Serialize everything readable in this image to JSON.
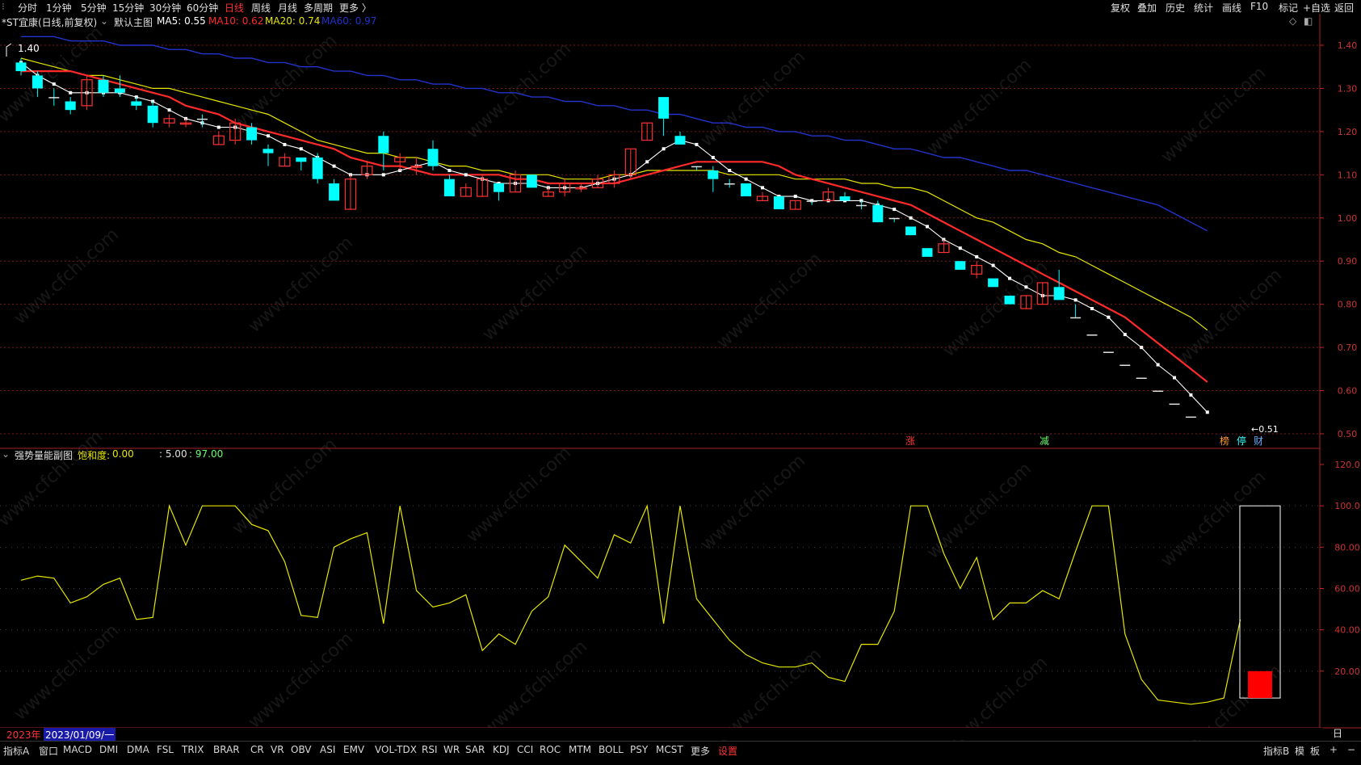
{
  "topbar": {
    "left_items": [
      "分时",
      "1分钟",
      "5分钟",
      "15分钟",
      "30分钟",
      "60分钟",
      "日线",
      "周线",
      "月线",
      "多周期",
      "更多 〉"
    ],
    "active_item": "日线",
    "right_items": [
      "复权",
      "叠加",
      "历史",
      "统计",
      "画线",
      "F10",
      "标记",
      "+自选",
      "返回"
    ]
  },
  "main_chart": {
    "title": "*ST宜康(日线,前复权)",
    "template": "默认主图",
    "ma5": {
      "label": "MA5:",
      "value": "0.55",
      "color": "#ffffff"
    },
    "ma10": {
      "label": "MA10:",
      "value": "0.62",
      "color": "#ff2a2a"
    },
    "ma20": {
      "label": "MA20:",
      "value": "0.74",
      "color": "#e6e600"
    },
    "ma60": {
      "label": "MA60:",
      "value": "0.97",
      "color": "#2233cc"
    },
    "high_marker": "1.40",
    "low_marker": "0.51",
    "y_ticks": [
      "1.40",
      "1.30",
      "1.20",
      "1.10",
      "1.00",
      "0.90",
      "0.80",
      "0.70",
      "0.60",
      "0.50"
    ],
    "event_tags": [
      {
        "text": "涨",
        "color": "#ff3333"
      },
      {
        "text": "减",
        "color": "#66ff66"
      },
      {
        "text": "榜",
        "color": "#ff9933"
      },
      {
        "text": "停",
        "color": "#33ffff"
      },
      {
        "text": "财",
        "color": "#66aaff"
      }
    ]
  },
  "sub_chart": {
    "title": "强势量能副图",
    "saturation_label": "饱和度:",
    "saturation_value": "0.00",
    "param1": ": 5.00",
    "param2": ": 97.00",
    "y_ticks": [
      "120.0",
      "100.0",
      "80.00",
      "60.00",
      "40.00",
      "20.00"
    ]
  },
  "chart_data": {
    "type": "candlestick",
    "price_range": [
      0.5,
      1.4
    ],
    "candles": [
      {
        "o": 1.36,
        "c": 1.34,
        "h": 1.37,
        "l": 1.33,
        "up": false
      },
      {
        "o": 1.33,
        "c": 1.3,
        "h": 1.34,
        "l": 1.28,
        "up": false
      },
      {
        "o": 1.28,
        "c": 1.28,
        "h": 1.3,
        "l": 1.26,
        "up": false
      },
      {
        "o": 1.27,
        "c": 1.25,
        "h": 1.28,
        "l": 1.24,
        "up": false
      },
      {
        "o": 1.26,
        "c": 1.32,
        "h": 1.33,
        "l": 1.25,
        "up": true
      },
      {
        "o": 1.32,
        "c": 1.29,
        "h": 1.33,
        "l": 1.28,
        "up": false
      },
      {
        "o": 1.3,
        "c": 1.29,
        "h": 1.33,
        "l": 1.28,
        "up": false
      },
      {
        "o": 1.27,
        "c": 1.26,
        "h": 1.28,
        "l": 1.25,
        "up": false
      },
      {
        "o": 1.26,
        "c": 1.22,
        "h": 1.27,
        "l": 1.21,
        "up": false
      },
      {
        "o": 1.22,
        "c": 1.23,
        "h": 1.24,
        "l": 1.21,
        "up": true
      },
      {
        "o": 1.22,
        "c": 1.22,
        "h": 1.23,
        "l": 1.21,
        "up": true
      },
      {
        "o": 1.23,
        "c": 1.23,
        "h": 1.24,
        "l": 1.21,
        "up": false
      },
      {
        "o": 1.17,
        "c": 1.19,
        "h": 1.2,
        "l": 1.17,
        "up": true
      },
      {
        "o": 1.18,
        "c": 1.22,
        "h": 1.23,
        "l": 1.17,
        "up": true
      },
      {
        "o": 1.21,
        "c": 1.18,
        "h": 1.22,
        "l": 1.17,
        "up": false
      },
      {
        "o": 1.16,
        "c": 1.15,
        "h": 1.17,
        "l": 1.12,
        "up": false
      },
      {
        "o": 1.12,
        "c": 1.14,
        "h": 1.15,
        "l": 1.12,
        "up": true
      },
      {
        "o": 1.13,
        "c": 1.14,
        "h": 1.14,
        "l": 1.11,
        "up": false
      },
      {
        "o": 1.14,
        "c": 1.09,
        "h": 1.15,
        "l": 1.08,
        "up": false
      },
      {
        "o": 1.08,
        "c": 1.04,
        "h": 1.09,
        "l": 1.04,
        "up": false
      },
      {
        "o": 1.02,
        "c": 1.09,
        "h": 1.1,
        "l": 1.02,
        "up": true
      },
      {
        "o": 1.1,
        "c": 1.12,
        "h": 1.13,
        "l": 1.09,
        "up": true
      },
      {
        "o": 1.19,
        "c": 1.15,
        "h": 1.2,
        "l": 1.11,
        "up": false
      },
      {
        "o": 1.13,
        "c": 1.14,
        "h": 1.15,
        "l": 1.11,
        "up": true
      },
      {
        "o": 1.12,
        "c": 1.12,
        "h": 1.14,
        "l": 1.1,
        "up": true
      },
      {
        "o": 1.16,
        "c": 1.12,
        "h": 1.18,
        "l": 1.11,
        "up": false
      },
      {
        "o": 1.09,
        "c": 1.05,
        "h": 1.1,
        "l": 1.05,
        "up": false
      },
      {
        "o": 1.05,
        "c": 1.07,
        "h": 1.08,
        "l": 1.05,
        "up": true
      },
      {
        "o": 1.05,
        "c": 1.09,
        "h": 1.1,
        "l": 1.05,
        "up": true
      },
      {
        "o": 1.08,
        "c": 1.06,
        "h": 1.08,
        "l": 1.04,
        "up": false
      },
      {
        "o": 1.06,
        "c": 1.1,
        "h": 1.11,
        "l": 1.06,
        "up": true
      },
      {
        "o": 1.1,
        "c": 1.07,
        "h": 1.1,
        "l": 1.07,
        "up": false
      },
      {
        "o": 1.05,
        "c": 1.06,
        "h": 1.07,
        "l": 1.05,
        "up": true
      },
      {
        "o": 1.06,
        "c": 1.08,
        "h": 1.09,
        "l": 1.05,
        "up": true
      },
      {
        "o": 1.07,
        "c": 1.07,
        "h": 1.08,
        "l": 1.06,
        "up": true
      },
      {
        "o": 1.07,
        "c": 1.09,
        "h": 1.1,
        "l": 1.07,
        "up": true
      },
      {
        "o": 1.08,
        "c": 1.1,
        "h": 1.11,
        "l": 1.07,
        "up": true
      },
      {
        "o": 1.1,
        "c": 1.16,
        "h": 1.16,
        "l": 1.09,
        "up": true
      },
      {
        "o": 1.18,
        "c": 1.22,
        "h": 1.22,
        "l": 1.18,
        "up": true
      },
      {
        "o": 1.28,
        "c": 1.23,
        "h": 1.28,
        "l": 1.19,
        "up": false
      },
      {
        "o": 1.19,
        "c": 1.17,
        "h": 1.2,
        "l": 1.17,
        "up": false
      },
      {
        "o": 1.12,
        "c": 1.12,
        "h": 1.12,
        "l": 1.11,
        "up": false
      },
      {
        "o": 1.11,
        "c": 1.09,
        "h": 1.12,
        "l": 1.06,
        "up": false
      },
      {
        "o": 1.08,
        "c": 1.08,
        "h": 1.09,
        "l": 1.07,
        "up": false
      },
      {
        "o": 1.08,
        "c": 1.05,
        "h": 1.08,
        "l": 1.05,
        "up": false
      },
      {
        "o": 1.05,
        "c": 1.04,
        "h": 1.06,
        "l": 1.04,
        "up": true
      },
      {
        "o": 1.05,
        "c": 1.02,
        "h": 1.05,
        "l": 1.02,
        "up": false
      },
      {
        "o": 1.02,
        "c": 1.04,
        "h": 1.04,
        "l": 1.02,
        "up": true
      },
      {
        "o": 1.04,
        "c": 1.04,
        "h": 1.04,
        "l": 1.03,
        "up": false
      },
      {
        "o": 1.04,
        "c": 1.06,
        "h": 1.07,
        "l": 1.04,
        "up": true
      },
      {
        "o": 1.05,
        "c": 1.04,
        "h": 1.06,
        "l": 1.04,
        "up": false
      },
      {
        "o": 1.03,
        "c": 1.03,
        "h": 1.04,
        "l": 1.02,
        "up": false
      },
      {
        "o": 1.03,
        "c": 0.99,
        "h": 1.04,
        "l": 0.99,
        "up": false
      },
      {
        "o": 1.0,
        "c": 1.0,
        "h": 1.0,
        "l": 0.99,
        "up": false
      },
      {
        "o": 0.98,
        "c": 0.96,
        "h": 0.98,
        "l": 0.96,
        "up": false
      },
      {
        "o": 0.93,
        "c": 0.91,
        "h": 0.93,
        "l": 0.91,
        "up": false
      },
      {
        "o": 0.92,
        "c": 0.94,
        "h": 0.95,
        "l": 0.92,
        "up": true
      },
      {
        "o": 0.9,
        "c": 0.88,
        "h": 0.9,
        "l": 0.88,
        "up": false
      },
      {
        "o": 0.87,
        "c": 0.89,
        "h": 0.9,
        "l": 0.86,
        "up": true
      },
      {
        "o": 0.86,
        "c": 0.84,
        "h": 0.86,
        "l": 0.84,
        "up": false
      },
      {
        "o": 0.82,
        "c": 0.8,
        "h": 0.82,
        "l": 0.8,
        "up": false
      },
      {
        "o": 0.79,
        "c": 0.82,
        "h": 0.82,
        "l": 0.79,
        "up": true
      },
      {
        "o": 0.8,
        "c": 0.85,
        "h": 0.85,
        "l": 0.8,
        "up": true
      },
      {
        "o": 0.84,
        "c": 0.81,
        "h": 0.88,
        "l": 0.81,
        "up": false
      },
      {
        "o": 0.77,
        "c": 0.77,
        "h": 0.8,
        "l": 0.77,
        "up": false
      },
      {
        "o": 0.73,
        "c": 0.73,
        "h": 0.73,
        "l": 0.73,
        "up": false
      },
      {
        "o": 0.69,
        "c": 0.69,
        "h": 0.69,
        "l": 0.69,
        "up": false
      },
      {
        "o": 0.66,
        "c": 0.66,
        "h": 0.66,
        "l": 0.66,
        "up": false
      },
      {
        "o": 0.63,
        "c": 0.63,
        "h": 0.63,
        "l": 0.63,
        "up": false
      },
      {
        "o": 0.6,
        "c": 0.6,
        "h": 0.6,
        "l": 0.6,
        "up": false
      },
      {
        "o": 0.57,
        "c": 0.57,
        "h": 0.57,
        "l": 0.57,
        "up": false
      },
      {
        "o": 0.54,
        "c": 0.54,
        "h": 0.54,
        "l": 0.54,
        "up": false
      }
    ],
    "ma5": [
      1.36,
      1.33,
      1.31,
      1.29,
      1.29,
      1.29,
      1.29,
      1.28,
      1.27,
      1.25,
      1.23,
      1.22,
      1.21,
      1.21,
      1.2,
      1.19,
      1.17,
      1.16,
      1.14,
      1.12,
      1.1,
      1.1,
      1.1,
      1.11,
      1.12,
      1.13,
      1.11,
      1.1,
      1.09,
      1.08,
      1.08,
      1.08,
      1.07,
      1.07,
      1.07,
      1.08,
      1.09,
      1.1,
      1.13,
      1.16,
      1.18,
      1.17,
      1.14,
      1.11,
      1.09,
      1.07,
      1.05,
      1.05,
      1.04,
      1.04,
      1.04,
      1.04,
      1.03,
      1.02,
      1.0,
      0.98,
      0.95,
      0.93,
      0.91,
      0.89,
      0.86,
      0.84,
      0.82,
      0.82,
      0.81,
      0.79,
      0.77,
      0.73,
      0.7,
      0.66,
      0.63,
      0.59,
      0.55
    ],
    "ma10": [
      1.34,
      1.34,
      1.34,
      1.34,
      1.33,
      1.32,
      1.31,
      1.3,
      1.29,
      1.28,
      1.26,
      1.25,
      1.24,
      1.22,
      1.21,
      1.2,
      1.19,
      1.18,
      1.17,
      1.16,
      1.14,
      1.13,
      1.12,
      1.12,
      1.11,
      1.1,
      1.1,
      1.1,
      1.1,
      1.1,
      1.09,
      1.09,
      1.08,
      1.08,
      1.08,
      1.08,
      1.08,
      1.09,
      1.1,
      1.11,
      1.12,
      1.13,
      1.13,
      1.13,
      1.13,
      1.13,
      1.12,
      1.1,
      1.09,
      1.08,
      1.07,
      1.06,
      1.05,
      1.04,
      1.03,
      1.01,
      0.99,
      0.97,
      0.95,
      0.93,
      0.91,
      0.89,
      0.87,
      0.85,
      0.83,
      0.81,
      0.79,
      0.77,
      0.74,
      0.71,
      0.68,
      0.65,
      0.62
    ],
    "ma20": [
      1.37,
      1.36,
      1.35,
      1.34,
      1.33,
      1.33,
      1.32,
      1.31,
      1.3,
      1.3,
      1.29,
      1.28,
      1.27,
      1.26,
      1.25,
      1.24,
      1.22,
      1.2,
      1.18,
      1.17,
      1.16,
      1.15,
      1.15,
      1.14,
      1.14,
      1.13,
      1.12,
      1.12,
      1.11,
      1.11,
      1.1,
      1.1,
      1.1,
      1.09,
      1.09,
      1.09,
      1.1,
      1.1,
      1.11,
      1.11,
      1.11,
      1.11,
      1.11,
      1.1,
      1.1,
      1.1,
      1.1,
      1.09,
      1.09,
      1.09,
      1.09,
      1.08,
      1.08,
      1.07,
      1.07,
      1.06,
      1.04,
      1.02,
      1.0,
      0.99,
      0.97,
      0.95,
      0.94,
      0.92,
      0.91,
      0.89,
      0.87,
      0.85,
      0.83,
      0.81,
      0.79,
      0.77,
      0.74
    ],
    "ma60": [
      1.42,
      1.42,
      1.42,
      1.41,
      1.41,
      1.41,
      1.4,
      1.4,
      1.4,
      1.39,
      1.39,
      1.38,
      1.38,
      1.37,
      1.37,
      1.36,
      1.36,
      1.35,
      1.35,
      1.34,
      1.34,
      1.33,
      1.33,
      1.32,
      1.32,
      1.31,
      1.31,
      1.3,
      1.3,
      1.29,
      1.29,
      1.28,
      1.28,
      1.27,
      1.27,
      1.26,
      1.26,
      1.25,
      1.25,
      1.24,
      1.24,
      1.23,
      1.22,
      1.22,
      1.21,
      1.21,
      1.2,
      1.2,
      1.19,
      1.19,
      1.18,
      1.18,
      1.17,
      1.16,
      1.16,
      1.15,
      1.14,
      1.14,
      1.13,
      1.12,
      1.11,
      1.11,
      1.1,
      1.09,
      1.08,
      1.07,
      1.06,
      1.05,
      1.04,
      1.03,
      1.01,
      0.99,
      0.97
    ],
    "energy": [
      64,
      66,
      65,
      53,
      56,
      62,
      65,
      45,
      46,
      100,
      81,
      100,
      100,
      100,
      91,
      88,
      73,
      47,
      46,
      80,
      84,
      87,
      43,
      100,
      59,
      51,
      53,
      57,
      30,
      38,
      33,
      49,
      56,
      81,
      73,
      65,
      86,
      82,
      100,
      43,
      100,
      55,
      45,
      35,
      28,
      24,
      22,
      22,
      24,
      17,
      15,
      33,
      33,
      49,
      100,
      100,
      77,
      60,
      75,
      45,
      53,
      53,
      59,
      55,
      78,
      100,
      100,
      38,
      16,
      6,
      5,
      4,
      5,
      7,
      45
    ],
    "energy_range": [
      0,
      120
    ],
    "energy_box": {
      "top": 100,
      "bottom": 7,
      "fill_top": 20,
      "fill_bottom": 7
    },
    "x_markers": [
      "2",
      "3",
      "4",
      "5"
    ]
  },
  "datebar": {
    "year": "2023年",
    "date": "2023/01/09/一",
    "right_label": "日线"
  },
  "bottombar": {
    "items": [
      "指标A",
      "窗口",
      "MACD",
      "DMI",
      "DMA",
      "FSL",
      "TRIX",
      "BRAR",
      "CR",
      "VR",
      "OBV",
      "ASI",
      "EMV",
      "VOL-TDX",
      "RSI",
      "WR",
      "SAR",
      "KDJ",
      "CCI",
      "ROC",
      "MTM",
      "BOLL",
      "PSY",
      "MCST",
      "更多",
      "设置"
    ],
    "right_items": [
      "指标B",
      "模",
      "板",
      "+",
      "−"
    ]
  },
  "watermark": "www.cfchi.com",
  "colors": {
    "up": "#ff3232",
    "down": "#00ffff",
    "grid": "#7a1a1a",
    "axis": "#cc2222",
    "energy": "#e6e600"
  }
}
